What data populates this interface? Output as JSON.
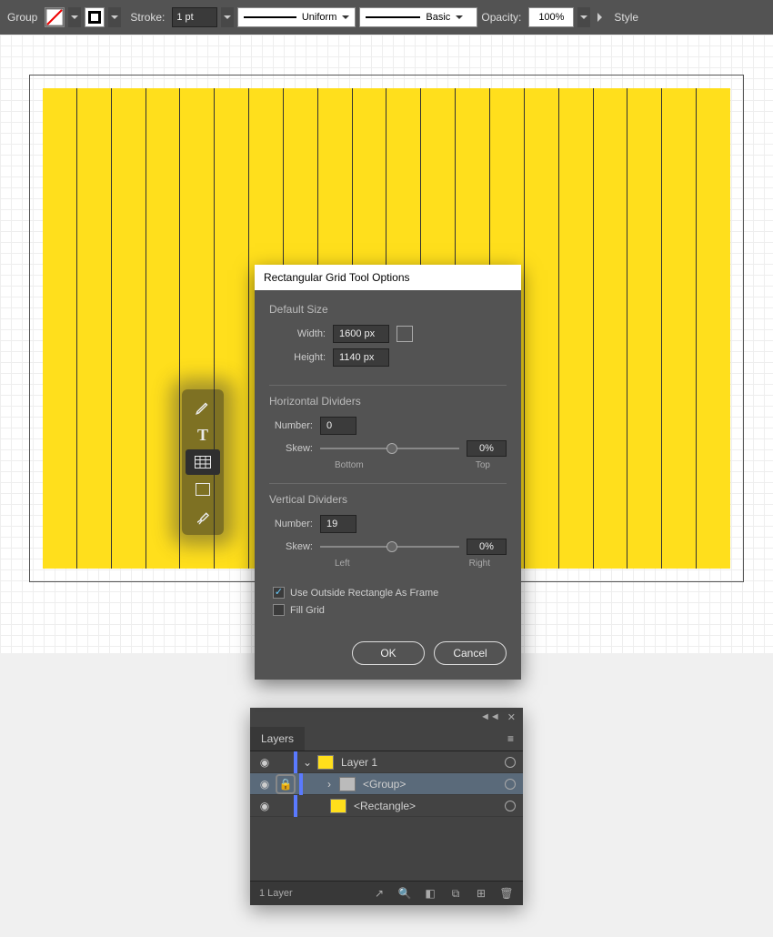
{
  "toolbar": {
    "selection_label": "Group",
    "stroke_label": "Stroke:",
    "stroke_value": "1 pt",
    "stroke_profile": "Uniform",
    "brush_def": "Basic",
    "opacity_label": "Opacity:",
    "opacity_value": "100%",
    "style_label": "Style"
  },
  "dialog": {
    "title": "Rectangular Grid Tool Options",
    "default_size": {
      "title": "Default Size",
      "width_label": "Width:",
      "width_value": "1600 px",
      "height_label": "Height:",
      "height_value": "1140 px"
    },
    "hdiv": {
      "title": "Horizontal Dividers",
      "number_label": "Number:",
      "number_value": "0",
      "skew_label": "Skew:",
      "skew_value": "0%",
      "low": "Bottom",
      "high": "Top"
    },
    "vdiv": {
      "title": "Vertical Dividers",
      "number_label": "Number:",
      "number_value": "19",
      "skew_label": "Skew:",
      "skew_value": "0%",
      "low": "Left",
      "high": "Right"
    },
    "use_outside": "Use Outside Rectangle As Frame",
    "fill_grid": "Fill Grid",
    "ok": "OK",
    "cancel": "Cancel"
  },
  "layers": {
    "tab": "Layers",
    "items": [
      {
        "name": "Layer 1",
        "thumb": "y",
        "expand": "⌄"
      },
      {
        "name": "<Group>",
        "thumb": "g",
        "expand": "›",
        "locked": true,
        "selected": true
      },
      {
        "name": "<Rectangle>",
        "thumb": "y"
      }
    ],
    "count": "1 Layer"
  }
}
